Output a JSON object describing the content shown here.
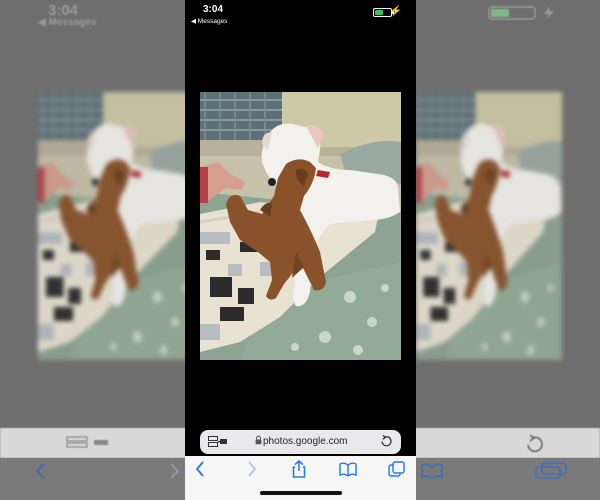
{
  "status_bar": {
    "time": "3:04",
    "back_label": "◀ Messages",
    "battery_level": 0.45
  },
  "browser": {
    "url": "photos.google.com",
    "lock_icon": "lock-icon",
    "reader_icon": "reader-mode-icon",
    "reload_icon": "reload-icon"
  },
  "toolbar": {
    "back_icon": "chevron-left-icon",
    "forward_icon": "chevron-right-icon",
    "share_icon": "share-icon",
    "bookmarks_icon": "book-icon",
    "tabs_icon": "tabs-icon"
  },
  "colors": {
    "accent": "#1e78f0",
    "battery": "#34c759",
    "background": "#000000"
  }
}
